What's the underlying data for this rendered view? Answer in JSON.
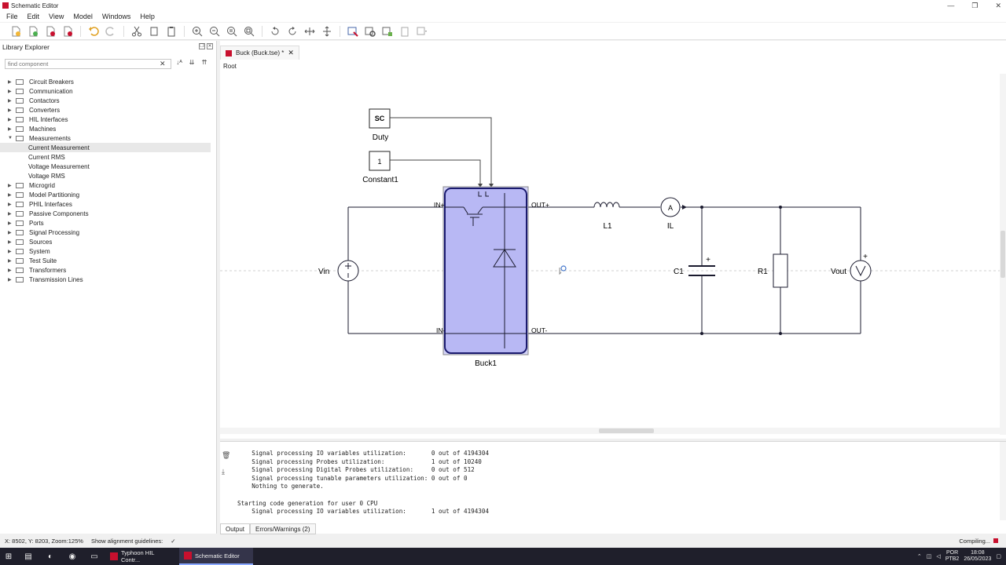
{
  "window": {
    "title": "Schematic Editor",
    "controls": [
      "—",
      "❐",
      "✕"
    ]
  },
  "menu": [
    "File",
    "Edit",
    "View",
    "Model",
    "Windows",
    "Help"
  ],
  "library": {
    "title": "Library Explorer",
    "search_placeholder": "find component",
    "items": [
      {
        "label": "Circuit Breakers"
      },
      {
        "label": "Communication"
      },
      {
        "label": "Contactors"
      },
      {
        "label": "Converters"
      },
      {
        "label": "HIL Interfaces"
      },
      {
        "label": "Machines"
      },
      {
        "label": "Measurements",
        "expanded": true
      },
      {
        "label": "Current Measurement",
        "child": true,
        "selected": true
      },
      {
        "label": "Current RMS",
        "child": true
      },
      {
        "label": "Voltage Measurement",
        "child": true
      },
      {
        "label": "Voltage RMS",
        "child": true
      },
      {
        "label": "Microgrid"
      },
      {
        "label": "Model Partitioning"
      },
      {
        "label": "PHIL Interfaces"
      },
      {
        "label": "Passive Components"
      },
      {
        "label": "Ports"
      },
      {
        "label": "Signal Processing"
      },
      {
        "label": "Sources"
      },
      {
        "label": "System"
      },
      {
        "label": "Test Suite"
      },
      {
        "label": "Transformers"
      },
      {
        "label": "Transmission Lines"
      }
    ]
  },
  "editor": {
    "tab_label": "Buck (Buck.tse) *",
    "breadcrumb": "Root"
  },
  "schematic": {
    "sc_block": "SC",
    "duty_label": "Duty",
    "const_value": "1",
    "const_label": "Constant1",
    "buck_label": "Buck1",
    "in_plus": "IN+",
    "in_minus": "IN-",
    "out_plus": "OUT+",
    "out_minus": "OUT-",
    "vin_label": "Vin",
    "l1_label": "L1",
    "il_label": "IL",
    "ammeter_symbol": "A",
    "c1_label": "C1",
    "r1_label": "R1",
    "vout_label": "Vout",
    "plus_sign": "+"
  },
  "output": {
    "lines": [
      "    Signal processing IO variables utilization:       0 out of 4194304",
      "    Signal processing Probes utilization:             1 out of 10240",
      "    Signal processing Digital Probes utilization:     0 out of 512",
      "    Signal processing tunable parameters utilization: 0 out of 0",
      "    Nothing to generate.",
      "",
      "Starting code generation for user 0 CPU",
      "    Signal processing IO variables utilization:       1 out of 4194304"
    ],
    "tabs": [
      "Output",
      "Errors/Warnings (2)"
    ]
  },
  "status": {
    "coords": "X: 8502, Y: 8203, Zoom:125%",
    "guidelines_label": "Show alignment guidelines:",
    "guidelines_check": "✓",
    "compiling": "Compiling..."
  },
  "taskbar": {
    "apps": [
      "Typhoon HIL Contr...",
      "Schematic Editor"
    ],
    "lang_top": "POR",
    "lang_bottom": "PTB2",
    "time": "18:08",
    "date": "26/05/2023"
  },
  "colors": {
    "accent": "#c8102e",
    "buck_fill": "#b8b8f4",
    "buck_stroke": "#1a1a6e",
    "wire": "#1a1a2e"
  }
}
